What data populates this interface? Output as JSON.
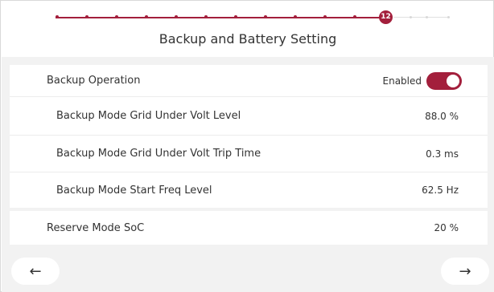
{
  "stepper": {
    "current_step": "12",
    "completed_ticks": 11,
    "remaining_ticks": 3,
    "accent_color": "#a31f3c"
  },
  "page": {
    "title": "Backup and Battery Setting"
  },
  "settings": {
    "backup_operation": {
      "label": "Backup Operation",
      "status": "Enabled",
      "enabled": true
    },
    "grid_under_volt_level": {
      "label": "Backup Mode Grid Under Volt Level",
      "value": "88.0 %"
    },
    "grid_under_volt_trip_time": {
      "label": "Backup Mode Grid Under Volt Trip Time",
      "value": "0.3 ms"
    },
    "start_freq_level": {
      "label": "Backup Mode Start Freq Level",
      "value": "62.5 Hz"
    },
    "reserve_mode_soc": {
      "label": "Reserve Mode SoC",
      "value": "20 %"
    }
  },
  "navigation": {
    "back_icon": "arrow-left-icon",
    "back_glyph": "←",
    "next_icon": "arrow-right-icon",
    "next_glyph": "→"
  }
}
